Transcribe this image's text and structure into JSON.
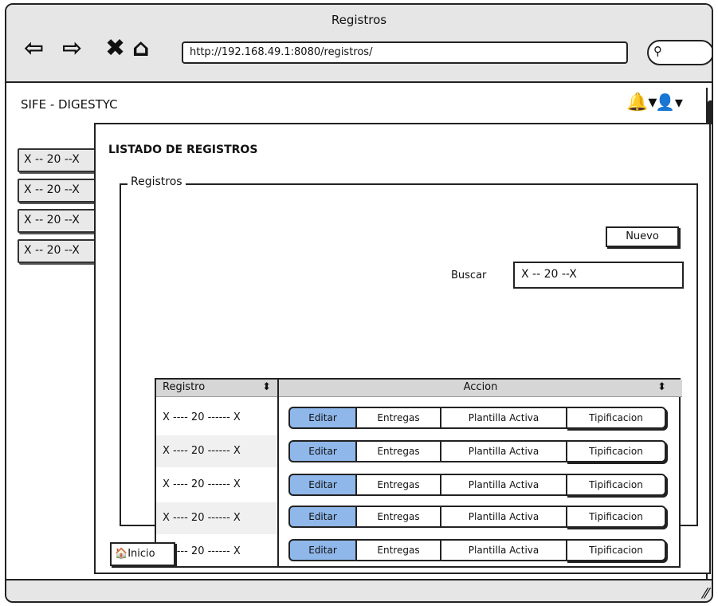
{
  "window": {
    "title": "Registros"
  },
  "browser": {
    "url": "http://192.168.49.1:8080/registros/",
    "nav_icons": [
      "back-arrow-icon",
      "forward-arrow-icon",
      "close-icon",
      "home-icon"
    ]
  },
  "app": {
    "name": "SIFE - DIGESTYC"
  },
  "sidebar": {
    "items": [
      {
        "label": "X -- 20 --X"
      },
      {
        "label": "X -- 20 --X"
      },
      {
        "label": "X -- 20 --X"
      },
      {
        "label": "X -- 20 --X"
      }
    ]
  },
  "main": {
    "title": "LISTADO DE REGISTROS",
    "group_label": "Registros",
    "new_button": "Nuevo",
    "search_label": "Buscar",
    "search_value": "X -- 20 --X",
    "table": {
      "columns": [
        "Registro",
        "Accion"
      ],
      "rows": [
        {
          "registro": "X ---- 20 ------ X"
        },
        {
          "registro": "X ---- 20 ------ X"
        },
        {
          "registro": "X ---- 20 ------ X"
        },
        {
          "registro": "X ---- 20 ------ X"
        },
        {
          "registro": "X ---- 20 ------ X"
        }
      ],
      "actions": [
        "Editar",
        "Entregas",
        "Plantilla Activa",
        "Tipificacion"
      ]
    },
    "home_button": "Inicio"
  },
  "colors": {
    "accent": "#8fb7ea",
    "chrome": "#e6e6e6"
  }
}
